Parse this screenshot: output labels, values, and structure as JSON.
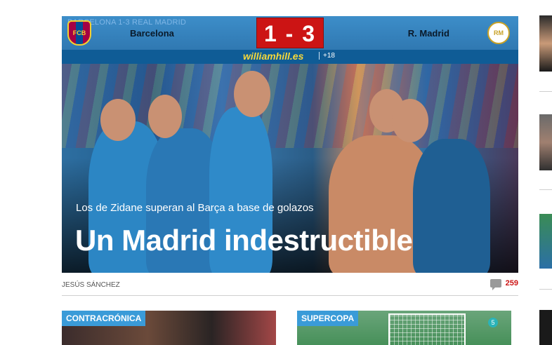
{
  "match": {
    "breadcrumb": "BARCELONA 1-3 REAL MADRID",
    "home_team": "Barcelona",
    "away_team": "R. Madrid",
    "score": "1 - 3",
    "home_crest": "FCB",
    "away_crest": "RM",
    "sponsor": "williamhill.es",
    "age_notice": "+18"
  },
  "article": {
    "kicker": "Los de Zidane superan al Barça a base de golazos",
    "headline": "Un Madrid indestructible",
    "author": "JESÚS SÁNCHEZ",
    "comment_count": "259"
  },
  "cards": [
    {
      "tag": "CONTRACRÓNICA"
    },
    {
      "tag": "SUPERCOPA",
      "badge": "5"
    }
  ],
  "colors": {
    "accent_blue": "#3a9bd8",
    "score_red": "#cc1414",
    "sponsor_yellow": "#f7d83a"
  },
  "icons": [
    "barcelona-crest-icon",
    "real-madrid-crest-icon",
    "comment-icon"
  ]
}
